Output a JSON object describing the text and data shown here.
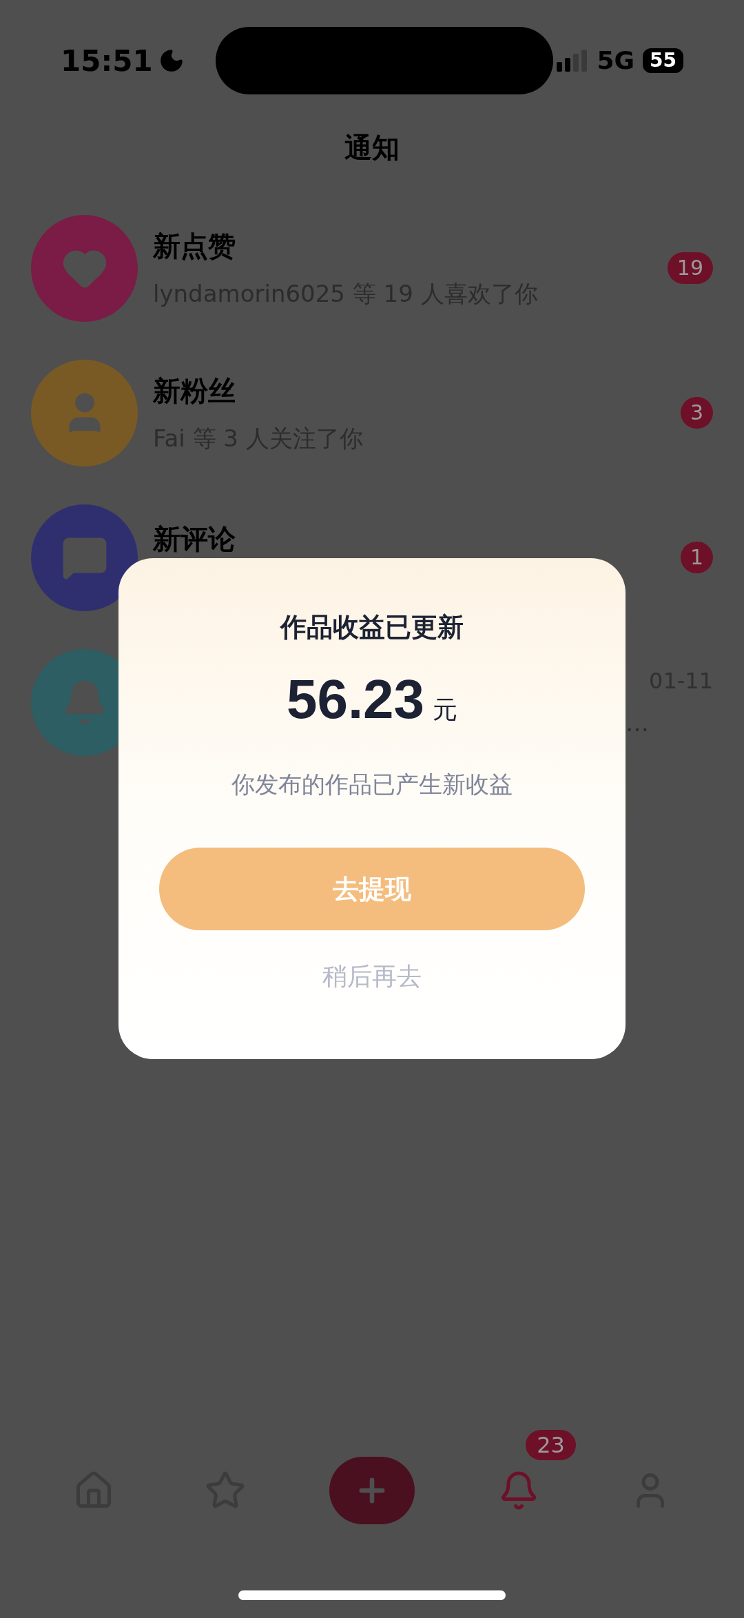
{
  "status_bar": {
    "time": "15:51",
    "network": "5G",
    "battery": "55"
  },
  "header": {
    "title": "通知"
  },
  "notifications": [
    {
      "kind": "heart",
      "color": "#7a1c45",
      "title": "新点赞",
      "preview": "lyndamorin6025 等 19 人喜欢了你",
      "badge": "19"
    },
    {
      "kind": "person",
      "color": "#7a5a24",
      "title": "新粉丝",
      "preview": "Fai 等 3 人关注了你",
      "badge": "3"
    },
    {
      "kind": "comment",
      "color": "#2f2f70",
      "title": "新评论",
      "badge": "1"
    },
    {
      "kind": "bell",
      "color": "#2d5e63",
      "preview": "…",
      "time": "01-11"
    }
  ],
  "dialog": {
    "title": "作品收益已更新",
    "amount": "56.23",
    "unit": "元",
    "message": "你发布的作品已产生新收益",
    "primary_button": "去提现",
    "secondary_button": "稍后再去"
  },
  "tab_bar": [
    {
      "kind": "home",
      "selected": false
    },
    {
      "kind": "star",
      "selected": false
    },
    {
      "kind": "add",
      "selected": false
    },
    {
      "kind": "bell",
      "selected": true,
      "badge": "23"
    },
    {
      "kind": "profile",
      "selected": false
    }
  ]
}
